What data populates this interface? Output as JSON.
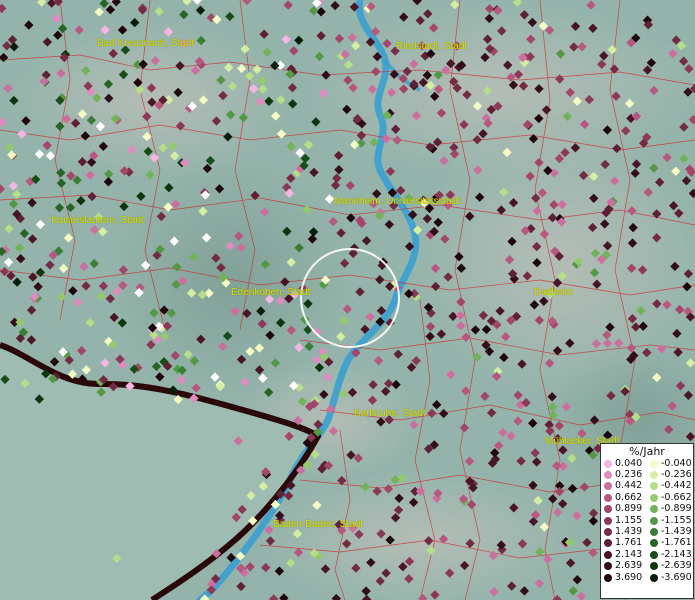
{
  "cities": [
    {
      "name": "Bad Kreuznach, Stadt"
    },
    {
      "name": "Riedstadt, Stadt"
    },
    {
      "name": "Kaiserslautern, Stadt"
    },
    {
      "name": "Mannheim, Universitätsstadt"
    },
    {
      "name": "Edenkoben, Stadt"
    },
    {
      "name": "Dielheim"
    },
    {
      "name": "Karlsruhe, Stadt"
    },
    {
      "name": "Mühlacker, Stadt"
    },
    {
      "name": "Baden-Baden, Stadt"
    }
  ],
  "legend": {
    "title": "%/Jahr",
    "positive": [
      {
        "label": "0.040",
        "color": "#f4b6e2"
      },
      {
        "label": "0.236",
        "color": "#e08cc0"
      },
      {
        "label": "0.442",
        "color": "#cc6f9e"
      },
      {
        "label": "0.662",
        "color": "#b85880"
      },
      {
        "label": "0.899",
        "color": "#a2476a"
      },
      {
        "label": "1.155",
        "color": "#8b3957"
      },
      {
        "label": "1.439",
        "color": "#742c45"
      },
      {
        "label": "1.761",
        "color": "#5e2035"
      },
      {
        "label": "2.143",
        "color": "#481626"
      },
      {
        "label": "2.639",
        "color": "#330d19"
      },
      {
        "label": "3.690",
        "color": "#1e050c"
      }
    ],
    "negative": [
      {
        "label": "-0.040",
        "color": "#f4fcc6"
      },
      {
        "label": "-0.236",
        "color": "#d4efa4"
      },
      {
        "label": "-0.442",
        "color": "#b4de88"
      },
      {
        "label": "-0.662",
        "color": "#93ca6e"
      },
      {
        "label": "-0.899",
        "color": "#72b258"
      },
      {
        "label": "-1.155",
        "color": "#539845"
      },
      {
        "label": "-1.439",
        "color": "#3a7e35"
      },
      {
        "label": "-1.761",
        "color": "#266526"
      },
      {
        "label": "-2.143",
        "color": "#174d19"
      },
      {
        "label": "-2.639",
        "color": "#0c3510"
      },
      {
        "label": "-3.690",
        "color": "#041e08"
      }
    ]
  },
  "colors": {
    "river": "#3aa0d0",
    "boundaries": "#d22020",
    "border": "#2a0808",
    "label": "#d8e000"
  }
}
